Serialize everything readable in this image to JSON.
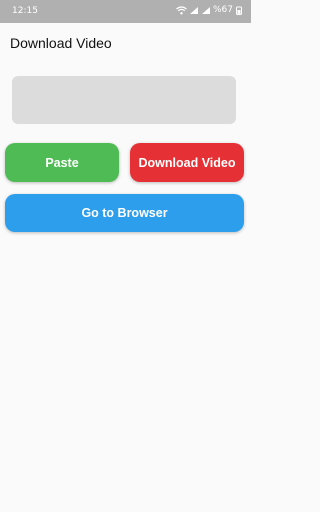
{
  "status_bar": {
    "time": "12:15",
    "battery": "%67"
  },
  "app": {
    "title": "Download Video"
  },
  "url_input": {
    "value": "",
    "placeholder": ""
  },
  "buttons": {
    "paste": "Paste",
    "download": "Download Video",
    "browser": "Go to Browser"
  },
  "colors": {
    "paste": "#4fbb55",
    "download": "#e53035",
    "browser": "#2d9eec",
    "status_bar": "#b0b0b0",
    "input_bg": "#dcdcdc"
  }
}
